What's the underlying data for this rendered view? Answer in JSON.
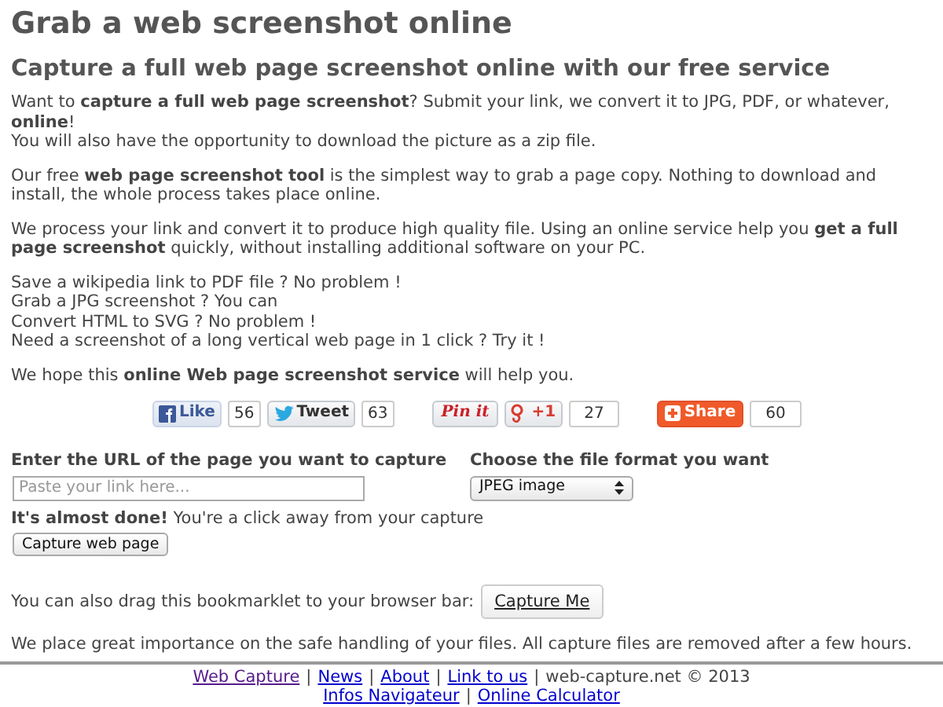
{
  "title": "Grab a web screenshot online",
  "subtitle": "Capture a full web page screenshot online with our free service",
  "paragraphs": [
    {
      "lines": [
        "Want to **capture a full web page screenshot**? Submit your link, we convert it to JPG, PDF, or whatever, **online**!",
        "You will also have the opportunity to download the picture as a zip file."
      ]
    },
    {
      "lines": [
        "Our free **web page screenshot tool** is the simplest way to grab a page copy. Nothing to download and install, the whole process takes place online."
      ]
    },
    {
      "lines": [
        "We process your link and convert it to produce high quality file. Using an online service help you **get a full page screenshot** quickly, without installing additional software on your PC."
      ]
    },
    {
      "lines": [
        "Save a wikipedia link to PDF file ? No problem !",
        "Grab a JPG screenshot ? You can",
        "Convert HTML to SVG ? No problem !",
        "Need a screenshot of a long vertical web page in 1 click ? Try it !"
      ]
    },
    {
      "lines": [
        "We hope this **online Web page screenshot service** will help you."
      ]
    }
  ],
  "social": [
    {
      "kind": "facebook",
      "label": "Like",
      "count": "56"
    },
    {
      "kind": "twitter",
      "label": "Tweet",
      "count": "63"
    },
    {
      "kind": "pinterest",
      "label": "Pin it"
    },
    {
      "kind": "gplus",
      "label": "+1",
      "count": "27"
    },
    {
      "kind": "share",
      "label": "Share",
      "count": "60"
    }
  ],
  "form": {
    "url_label": "Enter the URL of the page you want to capture",
    "url_placeholder": "Paste your link here...",
    "format_label": "Choose the file format you want",
    "format_value": "JPEG image",
    "almost": "**It's almost done!** You're a click away from your capture",
    "button": "Capture web page"
  },
  "bookmarklet": {
    "text": "You can also drag this bookmarklet to your browser bar:",
    "button": "Capture Me"
  },
  "notice": "We place great importance on the safe handling of your files. All capture files are removed after a few hours.",
  "footer": [
    [
      {
        "kind": "link",
        "text": "Web Capture",
        "visited": true
      },
      {
        "kind": "sep",
        "text": "|"
      },
      {
        "kind": "link",
        "text": "News",
        "visited": false
      },
      {
        "kind": "sep",
        "text": "|"
      },
      {
        "kind": "link",
        "text": "About",
        "visited": false
      },
      {
        "kind": "sep",
        "text": "|"
      },
      {
        "kind": "link",
        "text": "Link to us",
        "visited": false
      },
      {
        "kind": "sep",
        "text": "|"
      },
      {
        "kind": "text",
        "text": "web-capture.net © 2013"
      }
    ],
    [
      {
        "kind": "link",
        "text": "Infos Navigateur",
        "visited": false
      },
      {
        "kind": "sep",
        "text": "|"
      },
      {
        "kind": "link",
        "text": "Online Calculator",
        "visited": false
      }
    ]
  ]
}
